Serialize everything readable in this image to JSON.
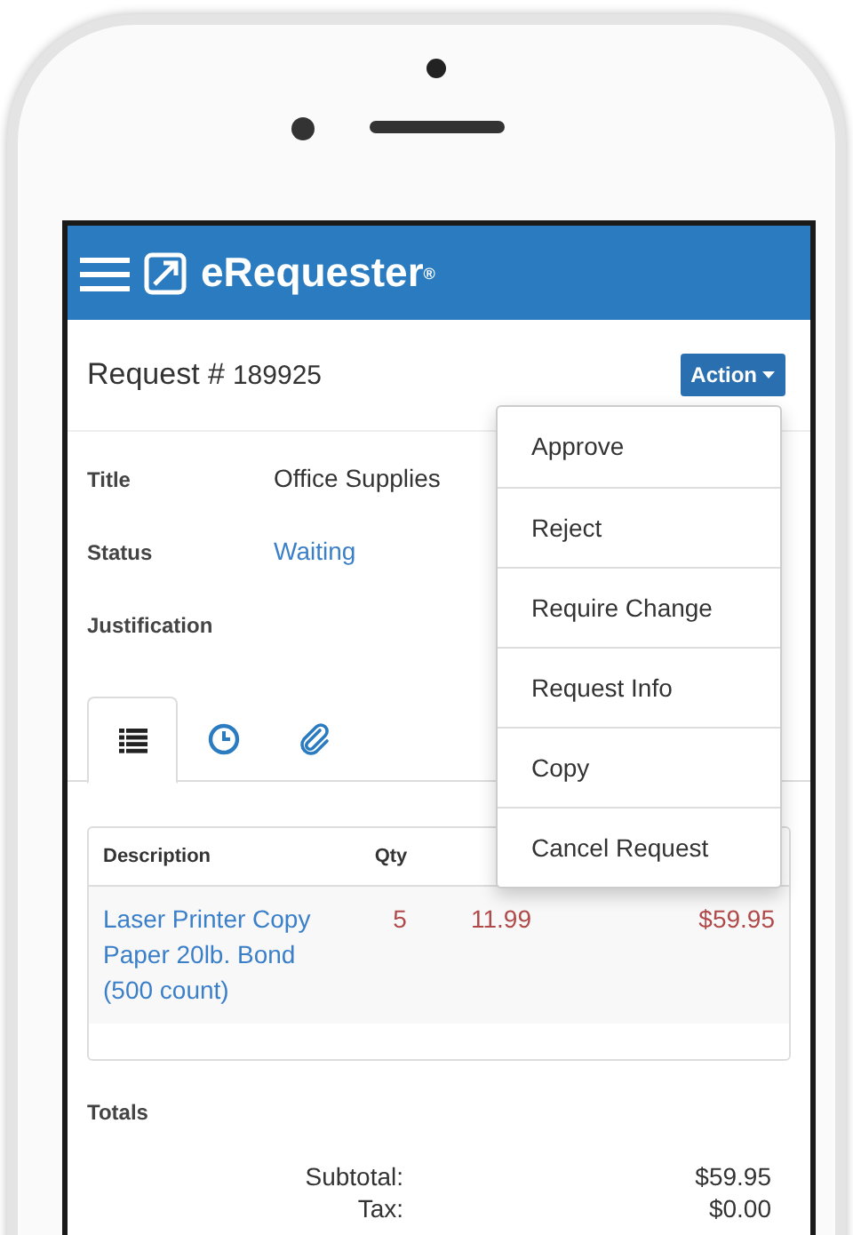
{
  "app": {
    "title": "eRequester$^{®}$"
  },
  "request": {
    "label": "Request #",
    "number": "189925"
  },
  "action_button": {
    "label": "Action",
    "expanded": true
  },
  "action_menu": [
    "Approve",
    "Reject",
    "Require Change",
    "Request Info",
    "Copy",
    "Cancel Request"
  ],
  "details": [
    {
      "label": "Title",
      "value": "Office Supplies",
      "kind": "text"
    },
    {
      "label": "Status",
      "value": "Waiting",
      "kind": "link"
    },
    {
      "label": "Justification"
    }
  ],
  "tabs": [
    {
      "kind": "list",
      "selected": true
    },
    {
      "kind": "clock",
      "selected": false
    },
    {
      "kind": "paperclip",
      "selected": false
    }
  ],
  "table": {
    "columns": [
      "Description",
      "Qty"
    ],
    "rows": [
      {
        "description": "Laser Printer Copy Paper 20lb. Bond (500 count)",
        "qty": "5",
        "price": "11.99",
        "total": "$59.95"
      }
    ]
  },
  "totals": {
    "heading": "Totals",
    "lines": [
      {
        "label": "Subtotal:",
        "value": "$59.95"
      },
      {
        "label": "Tax:",
        "value": "$0.00"
      }
    ]
  }
}
